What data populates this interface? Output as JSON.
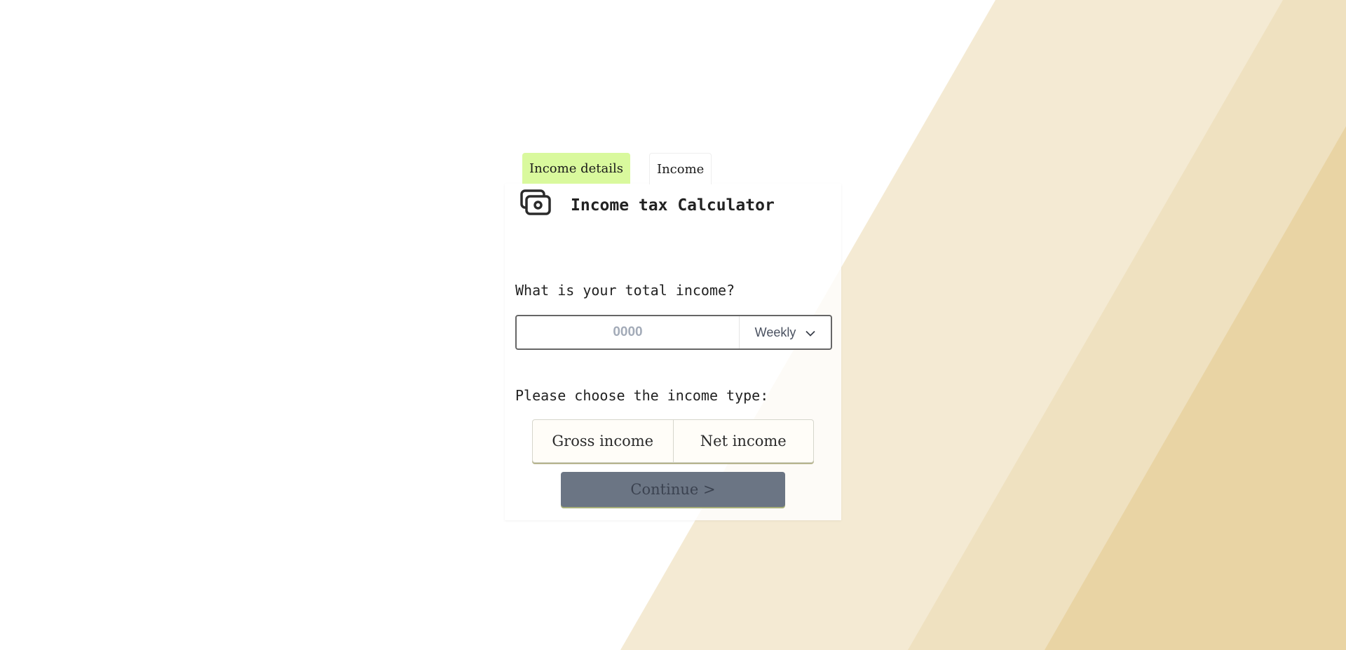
{
  "tabs": [
    {
      "label": "Income details",
      "active": true
    },
    {
      "label": "Income",
      "active": false
    }
  ],
  "card": {
    "icon": "money-icon",
    "title": "Income tax Calculator"
  },
  "income": {
    "question": "What is your total income?",
    "placeholder": "0000",
    "value": "",
    "period": "Weekly"
  },
  "income_type": {
    "question": "Please choose the income type:",
    "options": [
      "Gross income",
      "Net income"
    ]
  },
  "actions": {
    "continue_label": "Continue >"
  },
  "colors": {
    "active_tab": "#d9f99d",
    "continue_button": "#6b7584",
    "bg_stripe_light": "#f4ead3",
    "bg_stripe_mid": "#efe1c0",
    "bg_stripe_dark": "#e9d4a4"
  }
}
